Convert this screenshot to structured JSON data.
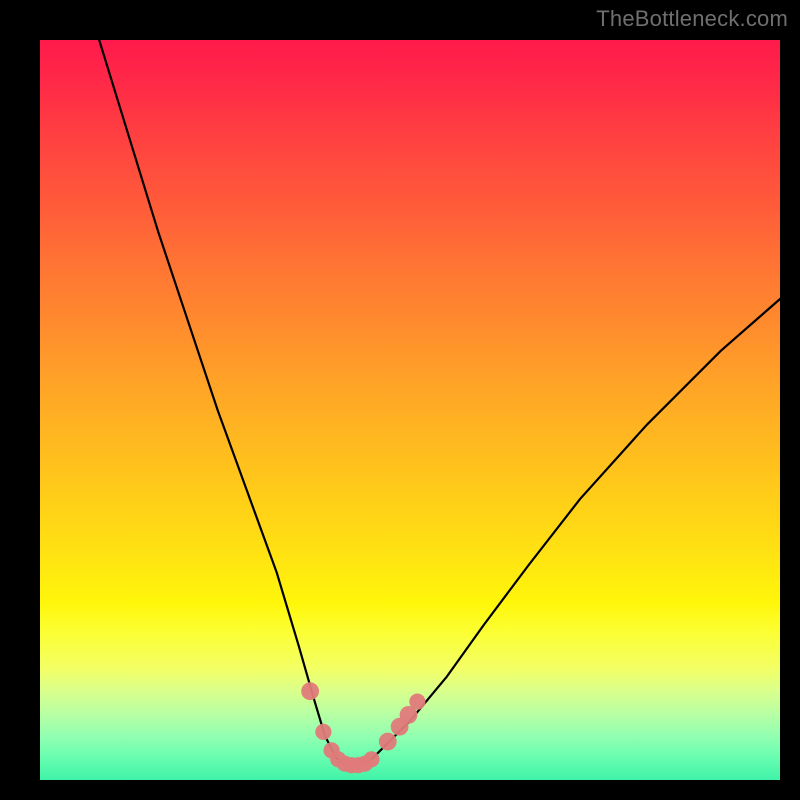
{
  "watermark": {
    "text": "TheBottleneck.com"
  },
  "colors": {
    "frame": "#000000",
    "curve": "#000000",
    "marker": "#e07a7a",
    "gradient_top": "#ff1a4b",
    "gradient_bottom": "#40f3a8"
  },
  "chart_data": {
    "type": "line",
    "title": "",
    "xlabel": "",
    "ylabel": "",
    "xlim": [
      0,
      100
    ],
    "ylim": [
      0,
      100
    ],
    "grid": false,
    "legend": false,
    "series": [
      {
        "name": "bottleneck-curve",
        "x": [
          8,
          12,
          16,
          20,
          24,
          28,
          32,
          35,
          37,
          38.5,
          40,
          41.5,
          43,
          45,
          47,
          50,
          55,
          60,
          66,
          73,
          82,
          92,
          100
        ],
        "y": [
          100,
          87,
          74,
          62,
          50,
          39,
          28,
          18,
          11,
          6,
          3,
          2,
          2,
          3,
          5,
          8,
          14,
          21,
          29,
          38,
          48,
          58,
          65
        ]
      }
    ],
    "markers": [
      {
        "x": 36.5,
        "y": 12,
        "r": 1.2
      },
      {
        "x": 38.3,
        "y": 6.5,
        "r": 1.1
      },
      {
        "x": 39.4,
        "y": 4.0,
        "r": 1.1
      },
      {
        "x": 40.3,
        "y": 2.8,
        "r": 1.1
      },
      {
        "x": 41.2,
        "y": 2.2,
        "r": 1.1
      },
      {
        "x": 42.1,
        "y": 2.0,
        "r": 1.1
      },
      {
        "x": 43.0,
        "y": 2.0,
        "r": 1.1
      },
      {
        "x": 43.9,
        "y": 2.2,
        "r": 1.1
      },
      {
        "x": 44.8,
        "y": 2.8,
        "r": 1.1
      },
      {
        "x": 47.0,
        "y": 5.2,
        "r": 1.2
      },
      {
        "x": 48.6,
        "y": 7.2,
        "r": 1.2
      },
      {
        "x": 49.8,
        "y": 8.8,
        "r": 1.2
      },
      {
        "x": 51.0,
        "y": 10.6,
        "r": 1.1
      }
    ]
  }
}
